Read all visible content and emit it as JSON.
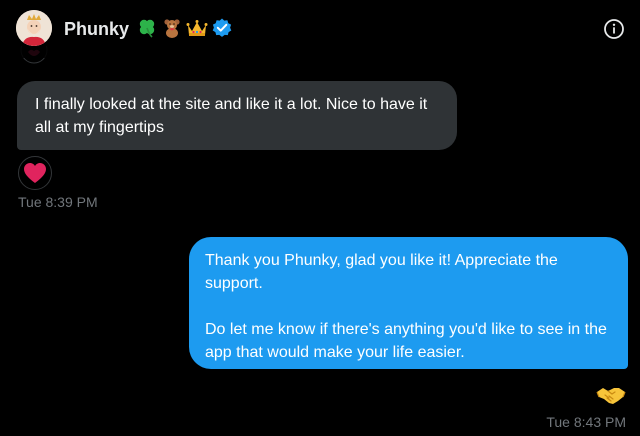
{
  "header": {
    "name": "Phunky",
    "badge_icons": [
      "four-leaf-clover-icon",
      "teddy-bear-icon",
      "crown-icon",
      "verified-badge-icon"
    ],
    "info_icon": "info-icon"
  },
  "messages": [
    {
      "direction": "incoming",
      "text": "I finally looked at the site and like it a lot. Nice to have it all at my fingertips",
      "reaction": "red-heart",
      "time": "Tue 8:39 PM"
    },
    {
      "direction": "outgoing",
      "paragraphs": [
        "Thank you Phunky, glad you like it! Appreciate the support.",
        "Do let me know if there's anything you'd like to see in the app that would make your life easier."
      ],
      "reaction": "handshake",
      "time": "Tue 8:43 PM"
    }
  ],
  "colors": {
    "background": "#000000",
    "incoming_bubble": "#2f3336",
    "outgoing_bubble": "#1d9bf0",
    "timestamp": "#71767b",
    "verified": "#1d9bf0",
    "heart": "#f91880"
  }
}
